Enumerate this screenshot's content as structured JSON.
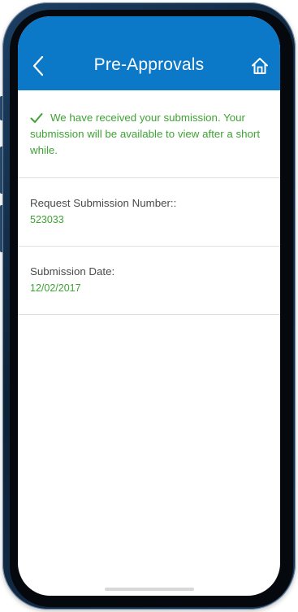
{
  "header": {
    "title": "Pre-Approvals",
    "background": "#0b78c8",
    "back_icon": "chevron-left-icon",
    "home_icon": "home-icon"
  },
  "confirmation": {
    "icon": "checkmark-icon",
    "message": "We have received your submission. Your submission will be available to view after a short while.",
    "color": "#3fa234"
  },
  "fields": [
    {
      "label": "Request Submission Number::",
      "value": "523033"
    },
    {
      "label": "Submission Date:",
      "value": "12/02/2017"
    }
  ]
}
